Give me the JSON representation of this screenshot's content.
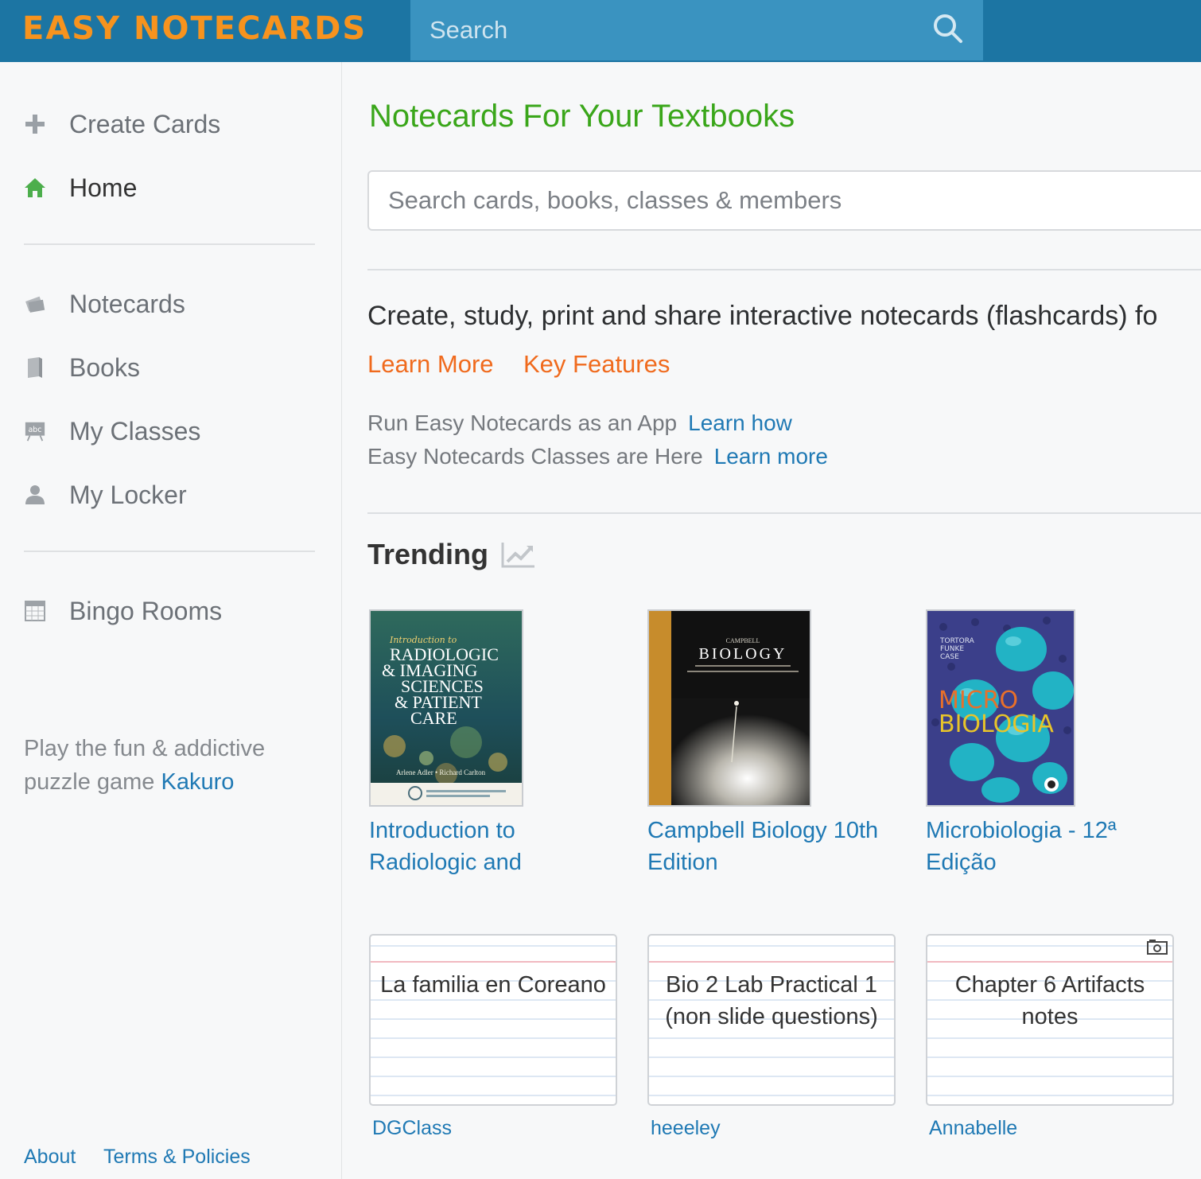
{
  "app": {
    "logo_text": "EASY NOTECARDS",
    "search_placeholder": "Search"
  },
  "sidebar": {
    "primary": [
      {
        "label": "Create Cards",
        "icon": "plus-icon"
      },
      {
        "label": "Home",
        "icon": "home-icon",
        "active": true
      }
    ],
    "nav": [
      {
        "label": "Notecards",
        "icon": "notecards-icon"
      },
      {
        "label": "Books",
        "icon": "book-icon"
      },
      {
        "label": "My Classes",
        "icon": "classroom-board-icon"
      },
      {
        "label": "My Locker",
        "icon": "user-icon"
      }
    ],
    "extra": [
      {
        "label": "Bingo Rooms",
        "icon": "bingo-card-icon"
      }
    ],
    "promo_text": "Play the fun & addictive puzzle game ",
    "promo_link": "Kakuro",
    "footer": {
      "about": "About",
      "terms": "Terms & Policies"
    }
  },
  "main": {
    "heading": "Notecards For Your Textbooks",
    "search_placeholder": "Search cards, books, classes & members",
    "tagline": "Create, study, print and share interactive notecards (flashcards) fo",
    "learn_more": "Learn More",
    "key_features": "Key Features",
    "app_text": "Run Easy Notecards as an App",
    "app_link": "Learn how",
    "classes_text": "Easy Notecards Classes are Here",
    "classes_link": "Learn more",
    "trending_label": "Trending",
    "books": [
      {
        "title": "Introduction to Radiologic and",
        "cover_lines": [
          "Introduction to",
          "RADIOLOGIC",
          "& IMAGING",
          "SCIENCES",
          "& PATIENT",
          "CARE"
        ],
        "cover_authors": "Arlene Adler • Richard Carlton"
      },
      {
        "title": "Campbell Biology 10th Edition",
        "cover_pre": "CAMPBELL",
        "cover_title": "BIOLOGY"
      },
      {
        "title": "Microbiologia - 12ª Edição",
        "cover_authors": [
          "TORTORA",
          "FUNKE",
          "CASE"
        ],
        "cover_lines": [
          "MICRO",
          "BIOLOGIA"
        ]
      }
    ],
    "cards": [
      {
        "text": "La familia en Coreano",
        "author": "DGClass",
        "has_image": false
      },
      {
        "text": "Bio 2 Lab Practical 1 (non slide questions)",
        "author": "heeeley",
        "has_image": false
      },
      {
        "text": "Chapter 6 Artifacts notes",
        "author": "Annabelle",
        "has_image": true
      }
    ]
  },
  "colors": {
    "topbar": "#1c75a3",
    "logo": "#f7931e",
    "heading_green": "#3aa61a",
    "link_blue": "#1f79b4",
    "orange_link": "#f06a1d"
  }
}
